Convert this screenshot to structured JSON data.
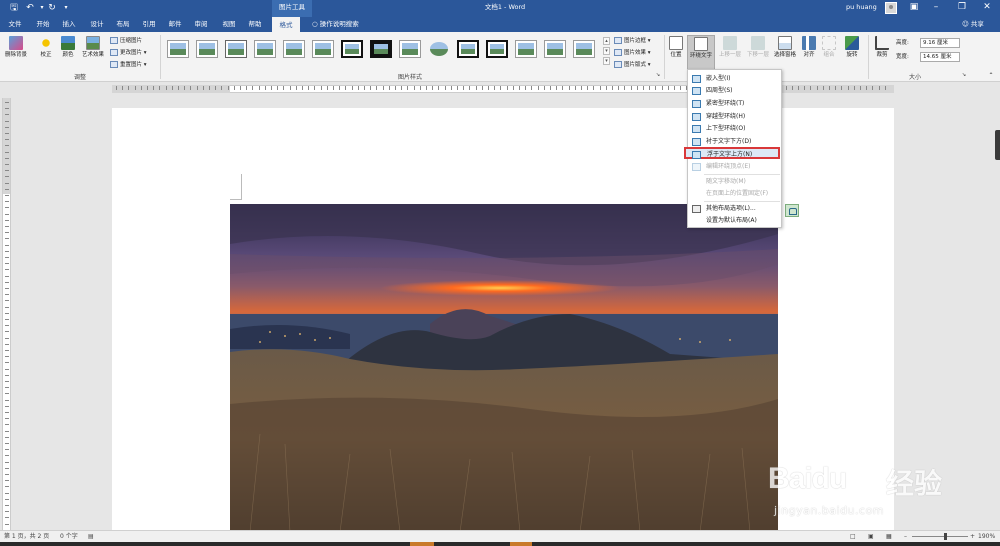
{
  "titlebar": {
    "context_tab_header": "图片工具",
    "doc_title": "文档1 - Word",
    "user_name": "pu huang"
  },
  "tabs": [
    "文件",
    "开始",
    "插入",
    "设计",
    "布局",
    "引用",
    "邮件",
    "审阅",
    "视图",
    "帮助",
    "格式"
  ],
  "active_tab": "格式",
  "tell_me": "操作说明搜索",
  "share": "共享",
  "ribbon": {
    "adjust": {
      "remove_bg": "删除背景",
      "corrections": "校正",
      "color": "颜色",
      "artistic": "艺术效果",
      "compress": "压缩图片",
      "change": "更改图片",
      "reset": "重置图片",
      "group_label": "调整"
    },
    "styles": {
      "border": "图片边框",
      "effects": "图片效果",
      "layout": "图片版式",
      "group_label": "图片样式"
    },
    "arrange": {
      "position": "位置",
      "wrap_text": "环绕文字",
      "bring_forward": "上移一层",
      "send_backward": "下移一层",
      "selection_pane": "选择窗格",
      "align": "对齐",
      "group": "组合",
      "rotate": "旋转"
    },
    "size": {
      "crop": "裁剪",
      "height_label": "高度:",
      "height_value": "9.16 厘米",
      "width_label": "宽度:",
      "width_value": "14.65 厘米",
      "group_label": "大小"
    }
  },
  "wrap_menu": {
    "items": [
      {
        "label": "嵌入型(I)",
        "enabled": true
      },
      {
        "label": "四周型(S)",
        "enabled": true
      },
      {
        "label": "紧密型环绕(T)",
        "enabled": true
      },
      {
        "label": "穿越型环绕(H)",
        "enabled": true
      },
      {
        "label": "上下型环绕(O)",
        "enabled": true
      },
      {
        "label": "衬于文字下方(D)",
        "enabled": true
      },
      {
        "label": "浮于文字上方(N)",
        "enabled": true,
        "selected": true
      },
      {
        "label": "编辑环绕顶点(E)",
        "enabled": false
      },
      {
        "label": "随文字移动(M)",
        "enabled": false
      },
      {
        "label": "在页面上的位置固定(F)",
        "enabled": false
      },
      {
        "label": "其他布局选项(L)...",
        "enabled": true
      },
      {
        "label": "设置为默认布局(A)",
        "enabled": true
      }
    ]
  },
  "status": {
    "pages": "第 1 页，共 2 页",
    "words": "0 个字",
    "zoom": "190%"
  },
  "watermark": {
    "brand": "Baidu",
    "cn": "经验",
    "url": "jingyan.baidu.com"
  },
  "colors": {
    "word_blue": "#2b579a",
    "ribbon_bg": "#f3f3f3",
    "highlight_red": "#d9383a"
  }
}
